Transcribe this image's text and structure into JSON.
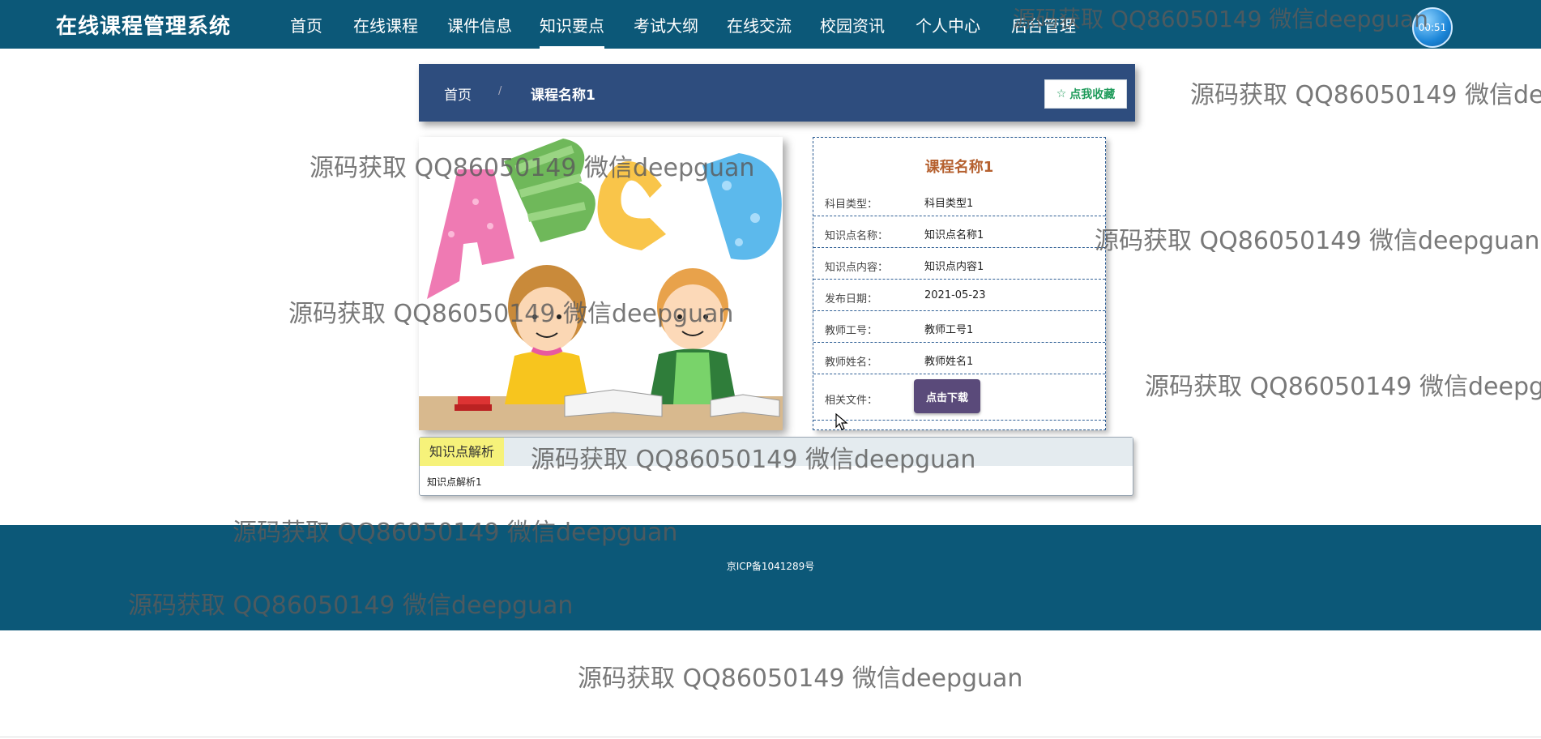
{
  "header": {
    "brand": "在线课程管理系统",
    "nav": [
      {
        "label": "首页",
        "active": false
      },
      {
        "label": "在线课程",
        "active": false
      },
      {
        "label": "课件信息",
        "active": false
      },
      {
        "label": "知识要点",
        "active": true
      },
      {
        "label": "考试大纲",
        "active": false
      },
      {
        "label": "在线交流",
        "active": false
      },
      {
        "label": "校园资讯",
        "active": false
      },
      {
        "label": "个人中心",
        "active": false
      },
      {
        "label": "后台管理",
        "active": false
      }
    ],
    "user_badge": "00:51"
  },
  "breadcrumb": {
    "home": "首页",
    "separator": "/",
    "current": "课程名称1",
    "favorite_label": "点我收藏",
    "favorite_icon": "star-outline-icon"
  },
  "detail": {
    "title": "课程名称1",
    "rows": [
      {
        "label": "科目类型：",
        "value": "科目类型1"
      },
      {
        "label": "知识点名称：",
        "value": "知识点名称1"
      },
      {
        "label": "知识点内容：",
        "value": "知识点内容1"
      },
      {
        "label": "发布日期：",
        "value": "2021-05-23"
      },
      {
        "label": "教师工号：",
        "value": "教师工号1"
      },
      {
        "label": "教师姓名：",
        "value": "教师姓名1"
      }
    ],
    "file_label": "相关文件：",
    "download_label": "点击下载"
  },
  "analysis": {
    "tag": "知识点解析",
    "content": "知识点解析1"
  },
  "footer": {
    "icp": "京ICP备1041289号"
  },
  "watermark": "源码获取 QQ86050149 微信deepguan",
  "colors": {
    "nav_bg": "#0c5878",
    "breadcrumb_bg": "#2e4d7e",
    "title_accent": "#b5602f",
    "download_btn": "#5a4a7a",
    "analysis_tag": "#f6f27a"
  }
}
